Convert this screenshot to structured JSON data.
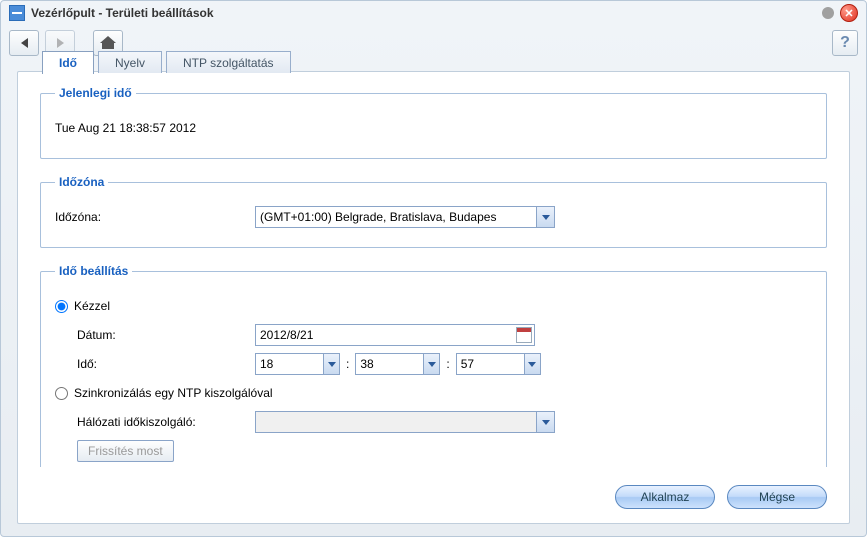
{
  "window": {
    "title": "Vezérlőpult - Területi beállítások"
  },
  "tabs": {
    "time": "Idő",
    "language": "Nyelv",
    "ntp": "NTP szolgáltatás"
  },
  "current_time_section": {
    "legend": "Jelenlegi idő",
    "value": "Tue Aug 21 18:38:57 2012"
  },
  "timezone_section": {
    "legend": "Időzóna",
    "label": "Időzóna:",
    "value": "(GMT+01:00) Belgrade, Bratislava, Budapes"
  },
  "time_setting_section": {
    "legend": "Idő beállítás",
    "manual_label": "Kézzel",
    "date_label": "Dátum:",
    "date_value": "2012/8/21",
    "time_label": "Idő:",
    "hour": "18",
    "minute": "38",
    "second": "57",
    "ntp_label": "Szinkronizálás egy NTP kiszolgálóval",
    "server_label": "Hálózati időkiszolgáló:",
    "server_value": "",
    "refresh_label": "Frissítés most"
  },
  "footer": {
    "apply": "Alkalmaz",
    "cancel": "Mégse"
  }
}
